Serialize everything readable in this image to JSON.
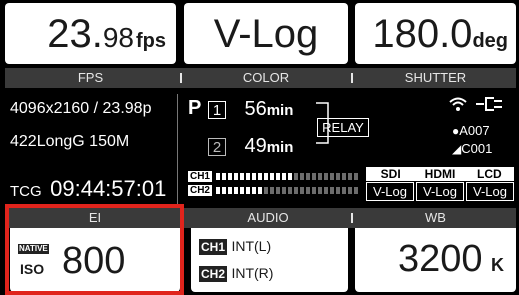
{
  "top": {
    "fps": {
      "value": "23.",
      "decimal": "98",
      "unit": "fps",
      "label": "FPS"
    },
    "color": {
      "value": "V-Log",
      "label": "COLOR"
    },
    "shutter": {
      "value": "180.0",
      "unit": "deg",
      "label": "SHUTTER"
    }
  },
  "middle": {
    "resolution": "4096x2160 / 23.98p",
    "codec": "422LongG 150M",
    "tc_label": "TCG",
    "timecode": "09:44:57:01",
    "p_label": "P",
    "slot1": {
      "num": "1",
      "time": "56",
      "unit": "min"
    },
    "slot2": {
      "num": "2",
      "time": "49",
      "unit": "min"
    },
    "relay": "RELAY",
    "ch1": "CH1",
    "ch2": "CH2",
    "card_a": "A007",
    "card_c": "C001",
    "outputs": {
      "labels": [
        "SDI",
        "HDMI",
        "LCD"
      ],
      "values": [
        "V-Log",
        "V-Log",
        "V-Log"
      ]
    }
  },
  "bottom": {
    "ei": {
      "label": "EI",
      "native": "NATIVE",
      "iso": "ISO",
      "value": "800"
    },
    "audio": {
      "label": "AUDIO",
      "ch1": "CH1",
      "ch1_val": "INT(L)",
      "ch2": "CH2",
      "ch2_val": "INT(R)"
    },
    "wb": {
      "label": "WB",
      "value": "3200",
      "unit": "K"
    }
  },
  "colors": {
    "highlight": "#e0241c",
    "tile": "#ffffff",
    "header": "#3a3a3a",
    "background": "#000000"
  },
  "meter": {
    "ch1_level": 0.5,
    "ch2_level": 0.3
  }
}
